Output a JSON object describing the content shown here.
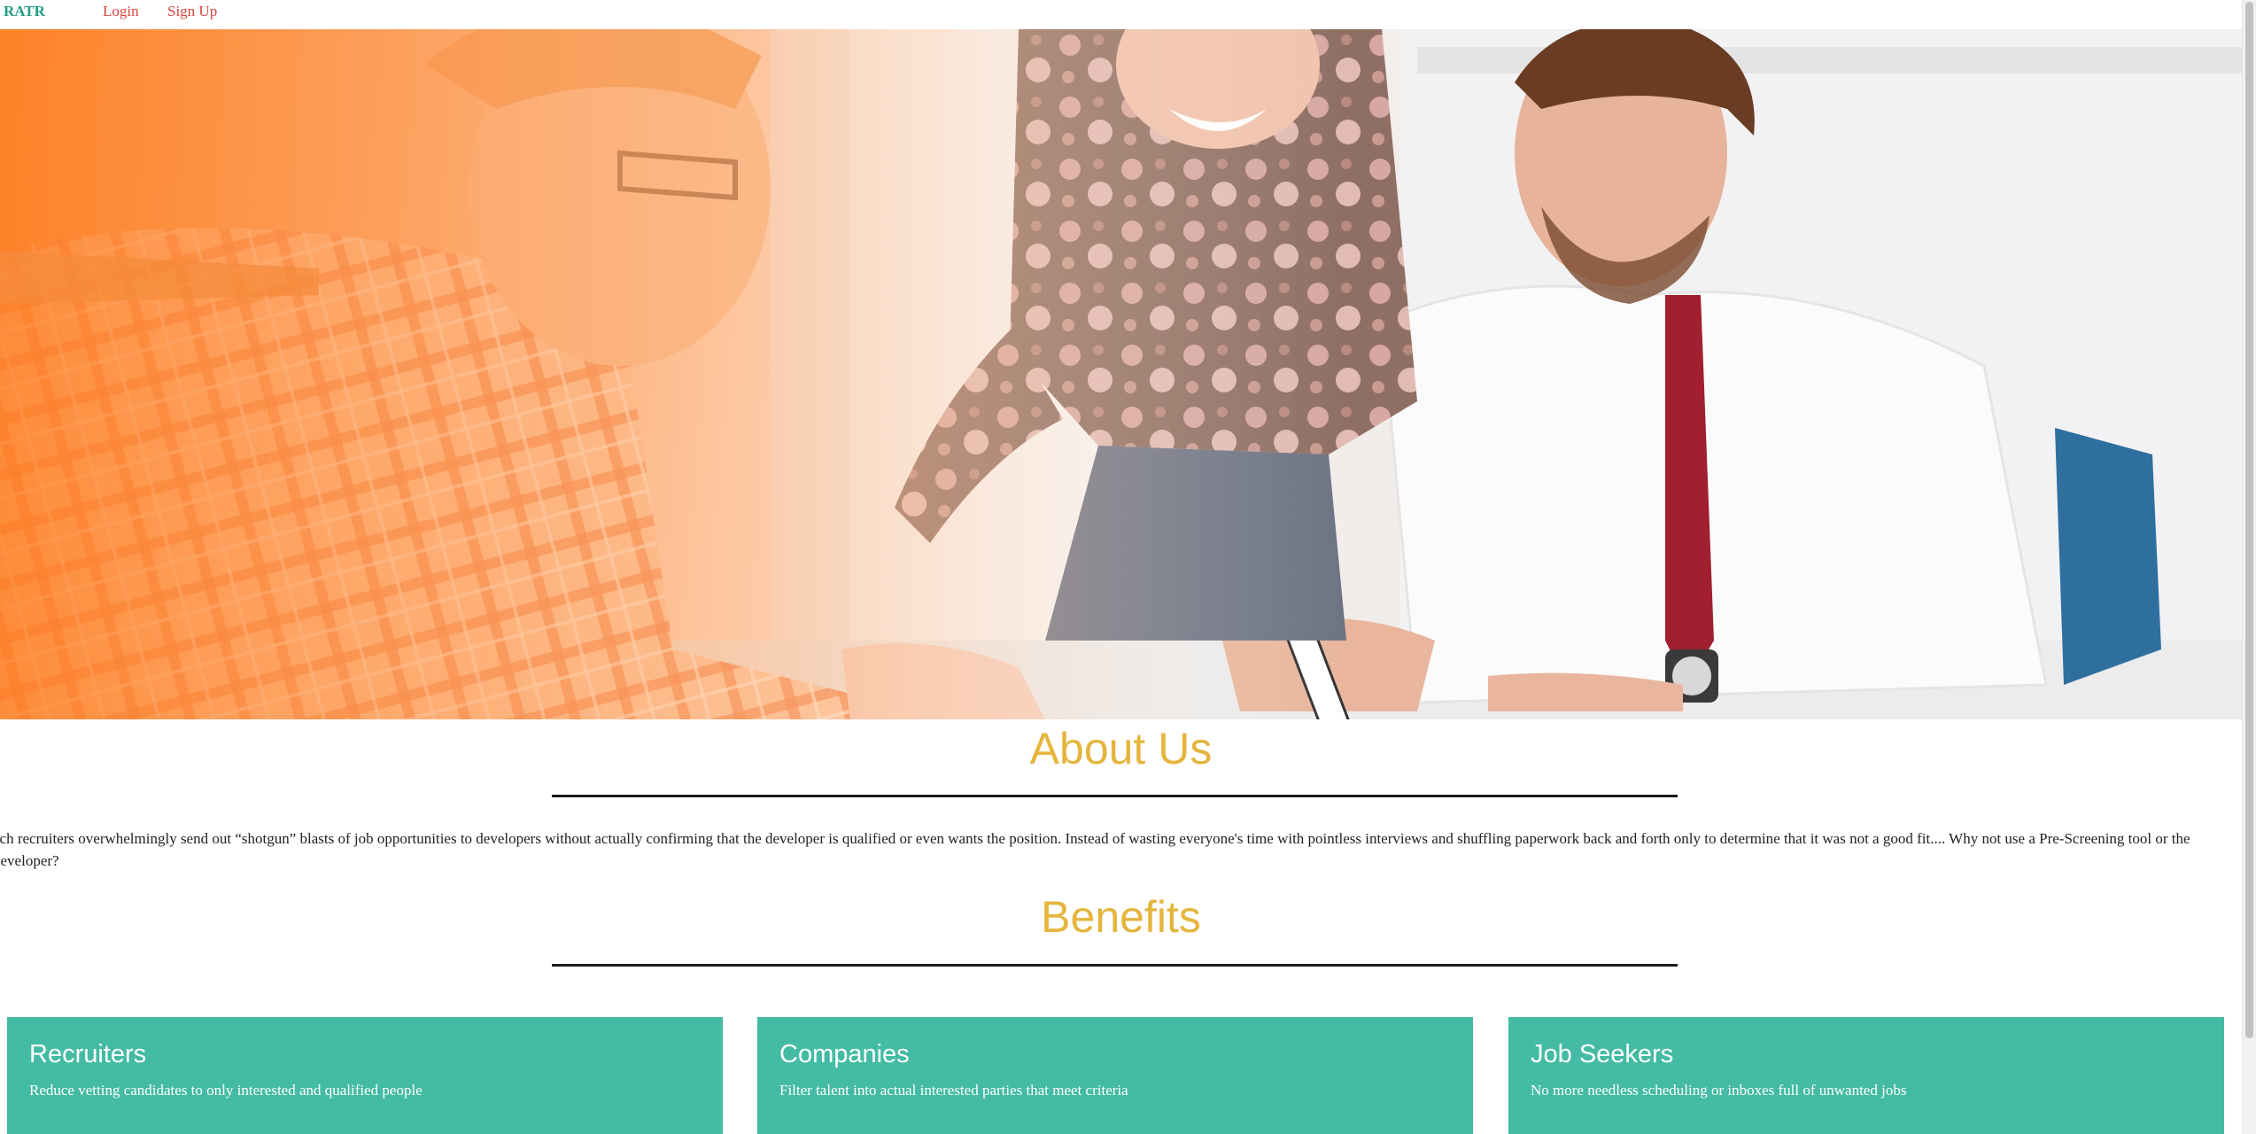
{
  "nav": {
    "brand": "RATR",
    "login_label": "Login",
    "signup_label": "Sign Up"
  },
  "hero": {
    "image_description_icon": "hero-photo"
  },
  "about": {
    "title": "About Us",
    "text": "ech recruiters overwhelmingly send out “shotgun” blasts of job opportunities to developers without actually confirming that the developer is qualified or even wants the position. Instead of wasting everyone's time with pointless interviews and shuffling paperwork back and forth only to determine that it was not a good fit.... Why not use a Pre-Screening tool or the developer?"
  },
  "benefits": {
    "title": "Benefits",
    "cards": [
      {
        "title": "Recruiters",
        "text": "Reduce vetting candidates to only interested and qualified people"
      },
      {
        "title": "Companies",
        "text": "Filter talent into actual interested parties that meet criteria"
      },
      {
        "title": "Job Seekers",
        "text": "No more needless scheduling or inboxes full of unwanted jobs"
      }
    ]
  },
  "colors": {
    "brand": "#1f9e88",
    "nav_link": "#d9443c",
    "heading": "#e5b53c",
    "card_bg": "#44bba4"
  }
}
